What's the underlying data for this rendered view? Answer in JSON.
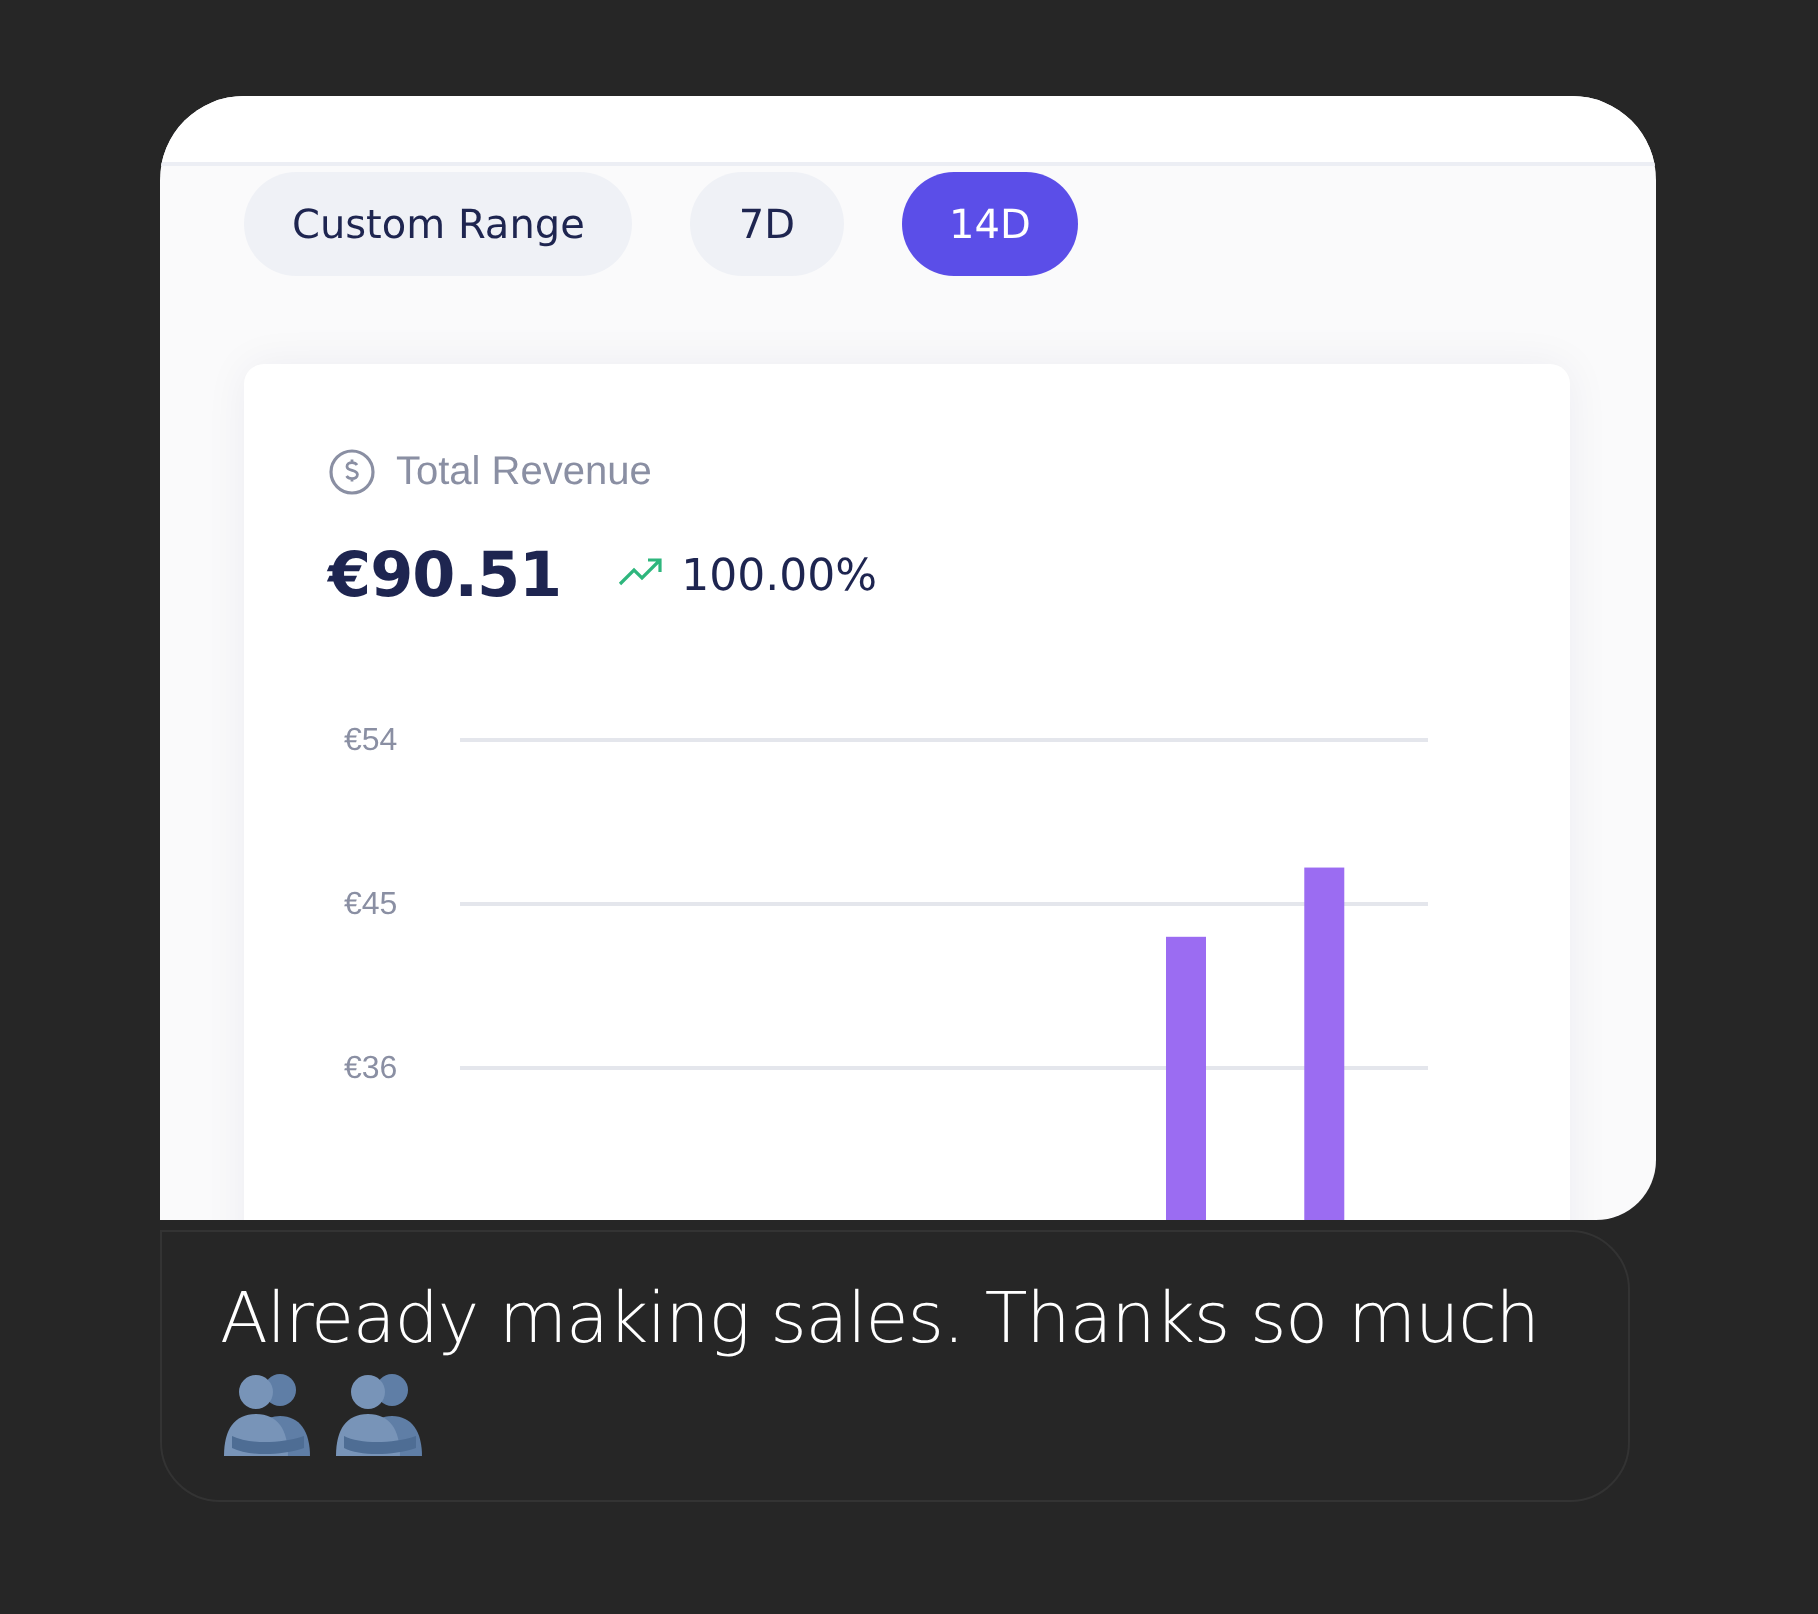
{
  "range_buttons": [
    {
      "label": "Custom Range",
      "selected": false
    },
    {
      "label": "7D",
      "selected": false
    },
    {
      "label": "14D",
      "selected": true
    }
  ],
  "revenue_card": {
    "title": "Total Revenue",
    "value": "€90.51",
    "change": "100.00%",
    "rising": true,
    "chart_data": {
      "type": "bar",
      "ylim": [
        0,
        54
      ],
      "yticks": [
        {
          "value": 36,
          "label": "€36"
        },
        {
          "value": 45,
          "label": "€45"
        },
        {
          "value": 54,
          "label": "€54"
        }
      ],
      "series": [
        {
          "color": "#9b6cf2",
          "values": [
            null,
            null,
            null,
            null,
            null,
            null,
            null,
            null,
            null,
            null,
            43.2,
            null,
            47.0,
            null
          ]
        }
      ]
    }
  },
  "message": {
    "text": "Already making sales. Thanks so much"
  }
}
